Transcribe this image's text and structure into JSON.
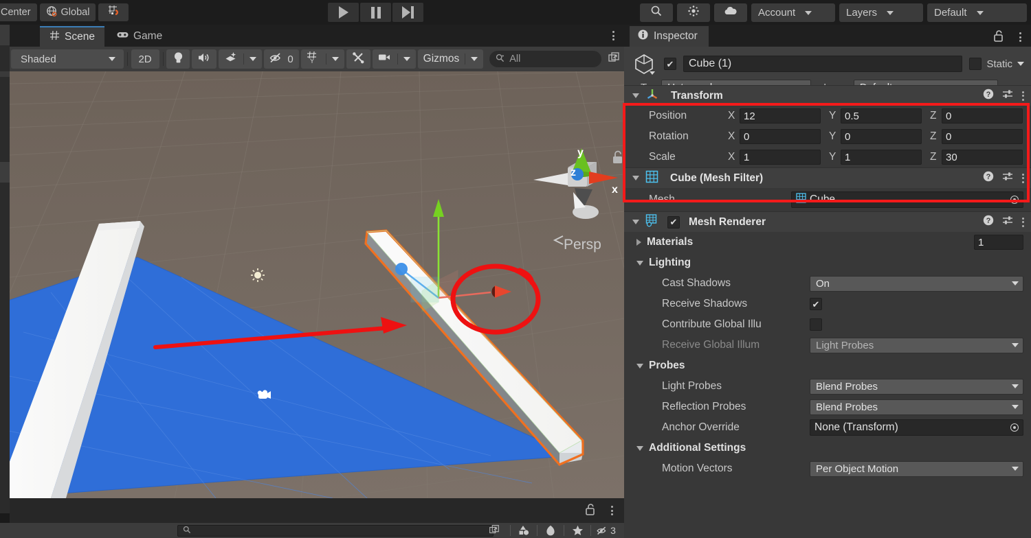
{
  "toolbar": {
    "pivot_mode": "Center",
    "handle_space": "Global",
    "snap_icon": "grid-snap-icon",
    "play": "play-icon",
    "pause": "pause-icon",
    "step": "step-icon",
    "search_icon": "search-icon",
    "preferences_icon": "settings-icon",
    "cloud_icon": "cloud-icon",
    "account": "Account",
    "layers": "Layers",
    "layout": "Default"
  },
  "scene_panel": {
    "tabs": [
      {
        "label": "Scene",
        "icon": "grid-icon",
        "active": true
      },
      {
        "label": "Game",
        "icon": "gamepad-icon",
        "active": false
      }
    ],
    "toolbar": {
      "draw_mode": "Shaded",
      "two_d": "2D",
      "lighting_icon": "lightbulb-icon",
      "audio_icon": "speaker-icon",
      "fx_icon": "effects-icon",
      "hidden_objects_count": "0",
      "hidden_icon": "eye-off-icon",
      "grid_icon": "grid-y-icon",
      "tools_icon": "tools-icon",
      "camera_icon": "camera-icon",
      "gizmos": "Gizmos",
      "search_placeholder": "All",
      "search_value": "",
      "maximize_icon": "maximize-icon"
    },
    "overlay": {
      "axis_x": "x",
      "axis_y": "y",
      "axis_z": "z",
      "projection": "Persp",
      "lock_icon": "unlock-icon"
    },
    "viewport": {
      "grid_color": "#6e6358",
      "plane_color": "#2f6ed8",
      "wall_color": "#f2f2f2",
      "selection_outline": "#f07020",
      "annotation_color": "#ee1111",
      "light_gizmo": "light-icon",
      "camera_gizmo": "camera-gizmo-icon"
    }
  },
  "status_bar": {
    "search_placeholder": "",
    "icons": [
      "scene-tools-icon",
      "tag-icon",
      "favorite-icon",
      "eye-off-icon"
    ],
    "hidden_count": "3"
  },
  "inspector": {
    "tab_label": "Inspector",
    "tab_icon": "info-icon",
    "lock_icon": "unlock-icon",
    "menu_icon": "kebab-menu-icon",
    "gameobject": {
      "icon": "cube-icon",
      "enabled": true,
      "name": "Cube (1)",
      "static_label": "Static",
      "static_checked": false,
      "tag_label": "Tag",
      "tag_value": "Untagged",
      "layer_label": "Layer",
      "layer_value": "Default"
    },
    "components": [
      {
        "title": "Transform",
        "icon": "transform-icon",
        "highlighted": true,
        "rows": [
          {
            "label": "Position",
            "axes": [
              "X",
              "Y",
              "Z"
            ],
            "values": [
              "12",
              "0.5",
              "0"
            ]
          },
          {
            "label": "Rotation",
            "axes": [
              "X",
              "Y",
              "Z"
            ],
            "values": [
              "0",
              "0",
              "0"
            ]
          },
          {
            "label": "Scale",
            "axes": [
              "X",
              "Y",
              "Z"
            ],
            "values": [
              "1",
              "1",
              "30"
            ]
          }
        ]
      },
      {
        "title": "Cube (Mesh Filter)",
        "icon": "mesh-filter-icon",
        "mesh_label": "Mesh",
        "mesh_value": "Cube"
      },
      {
        "title": "Mesh Renderer",
        "icon": "mesh-renderer-icon",
        "enabled": true,
        "materials_label": "Materials",
        "materials_count": "1",
        "lighting_label": "Lighting",
        "cast_shadows_label": "Cast Shadows",
        "cast_shadows_value": "On",
        "receive_shadows_label": "Receive Shadows",
        "receive_shadows_checked": true,
        "contribute_gi_label": "Contribute Global Illu",
        "contribute_gi_checked": false,
        "receive_gi_label": "Receive Global Illum",
        "receive_gi_value": "Light Probes",
        "probes_label": "Probes",
        "light_probes_label": "Light Probes",
        "light_probes_value": "Blend Probes",
        "reflection_probes_label": "Reflection Probes",
        "reflection_probes_value": "Blend Probes",
        "anchor_override_label": "Anchor Override",
        "anchor_override_value": "None (Transform)",
        "additional_label": "Additional Settings",
        "motion_vectors_label": "Motion Vectors",
        "motion_vectors_value": "Per Object Motion"
      }
    ]
  },
  "colors": {
    "accent_blue": "#3c7eb7",
    "highlight_red": "#f41a1a",
    "panel_bg": "#383838",
    "header_bg": "#3f3f3f",
    "toolbar_bg": "#1c1c1c"
  }
}
